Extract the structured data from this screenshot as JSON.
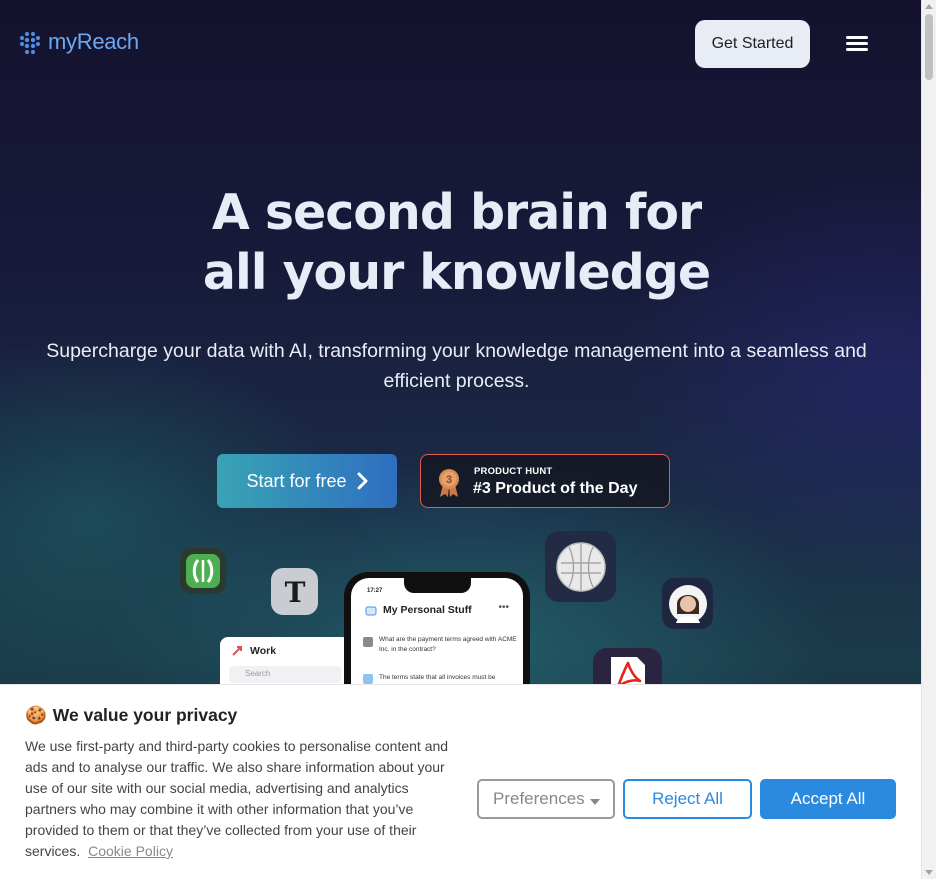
{
  "brand": {
    "name": "myReach",
    "accent": "#6fa8f0"
  },
  "nav": {
    "get_started": "Get Started",
    "menu_icon": "hamburger-icon"
  },
  "hero": {
    "headline_line1": "A second brain for",
    "headline_line2": "all your knowledge",
    "subhead": "Supercharge your data with AI, transforming your knowledge management into a seamless and efficient process."
  },
  "cta": {
    "start_label": "Start for free",
    "start_icon": "chevron-right-icon"
  },
  "product_hunt": {
    "kicker": "PRODUCT HUNT",
    "title": "#3 Product of the Day",
    "medal_number": "3",
    "border_color": "#e35b4c"
  },
  "mockup": {
    "work_title": "Work",
    "work_search": "Search",
    "phone_time": "17:27",
    "phone_title": "My Personal Stuff",
    "phone_menu": "•••",
    "question": "What are the payment terms agreed with ACME Inc. in the contract?",
    "answer": "The terms state that all invoices must be"
  },
  "floating_icons": [
    "fork-knife-icon",
    "nyt-logo-icon",
    "wikipedia-globe-icon",
    "avatar-icon",
    "pdf-icon"
  ],
  "cookie": {
    "emoji": "🍪",
    "title": "We value your privacy",
    "text": "We use first-party and third-party cookies to personalise content and ads and to analyse our traffic. We also share information about your use of our site with our social media, advertising and analytics partners who may combine it with other information that you’ve provided to them or that they’ve collected from your use of their services.",
    "policy_link": "Cookie Policy",
    "preferences": "Preferences",
    "reject": "Reject All",
    "accept": "Accept All",
    "accent": "#2a8ae0"
  }
}
